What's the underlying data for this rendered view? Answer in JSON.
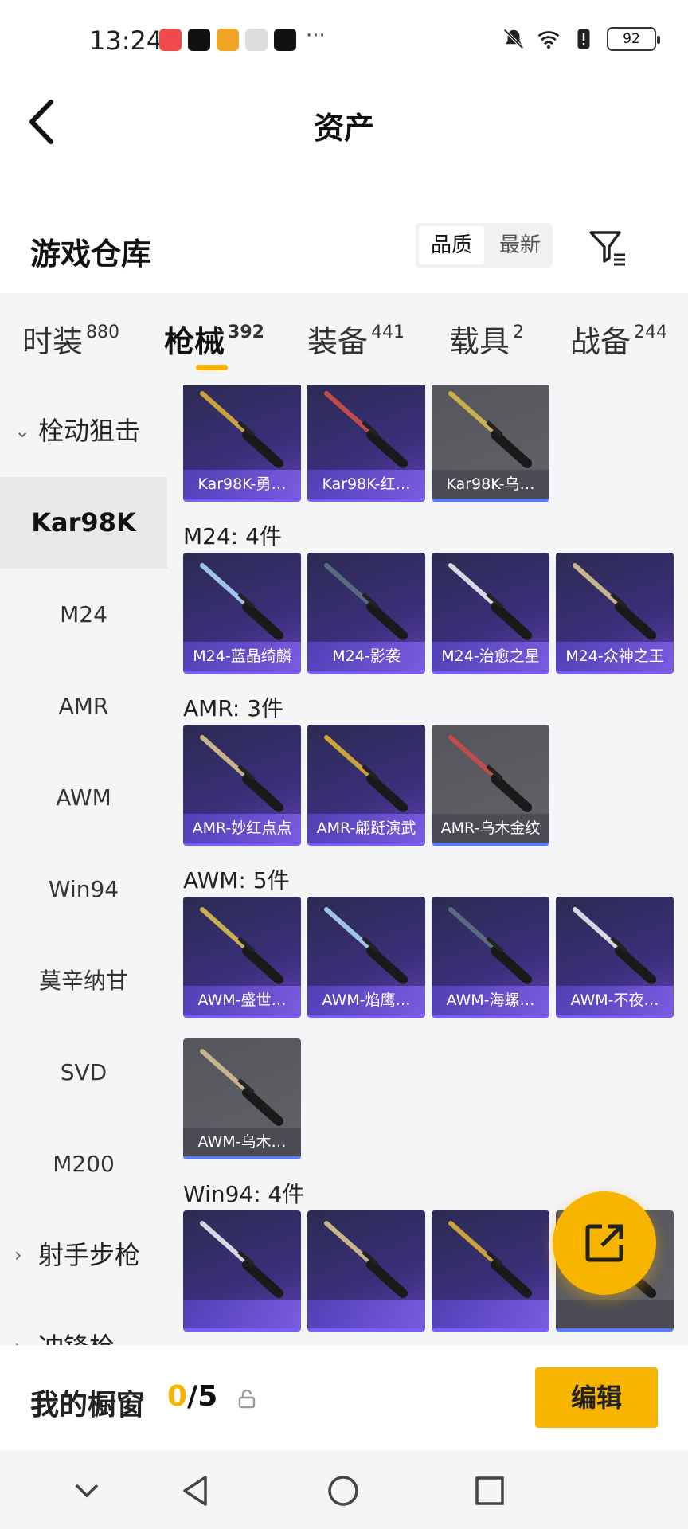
{
  "status_bar": {
    "time": "13:24",
    "dots": "···",
    "battery": "92"
  },
  "header": {
    "title": "资产"
  },
  "warehouse": {
    "title": "游戏仓库",
    "sort_options": [
      "品质",
      "最新"
    ],
    "active_sort": "品质"
  },
  "tabs": [
    {
      "label": "时装",
      "count": "880"
    },
    {
      "label": "枪械",
      "count": "392"
    },
    {
      "label": "装备",
      "count": "441"
    },
    {
      "label": "载具",
      "count": "2"
    },
    {
      "label": "战备",
      "count": "244"
    }
  ],
  "sidebar": {
    "categories": [
      {
        "label": "栓动狙击",
        "chevron": "down"
      },
      {
        "label": "射手步枪",
        "chevron": "right"
      },
      {
        "label": "冲锋枪",
        "chevron": "right"
      }
    ],
    "items": [
      "Kar98K",
      "M24",
      "AMR",
      "AWM",
      "Win94",
      "莫辛纳甘",
      "SVD",
      "M200"
    ],
    "active_item": "Kar98K"
  },
  "sections": [
    {
      "title": "",
      "cards": [
        {
          "label": "Kar98K-勇…",
          "style": "purple"
        },
        {
          "label": "Kar98K-红…",
          "style": "purple"
        },
        {
          "label": "Kar98K-乌…",
          "style": "gray"
        }
      ]
    },
    {
      "title": "M24: 4件",
      "cards": [
        {
          "label": "M24-蓝晶绮麟",
          "style": "purple"
        },
        {
          "label": "M24-影袭",
          "style": "purple"
        },
        {
          "label": "M24-治愈之星",
          "style": "purple"
        },
        {
          "label": "M24-众神之王",
          "style": "purple"
        }
      ]
    },
    {
      "title": "AMR: 3件",
      "cards": [
        {
          "label": "AMR-妙红点点",
          "style": "purple"
        },
        {
          "label": "AMR-翩跹演武",
          "style": "purple"
        },
        {
          "label": "AMR-乌木金纹",
          "style": "gray"
        }
      ]
    },
    {
      "title": "AWM: 5件",
      "cards": [
        {
          "label": "AWM-盛世…",
          "style": "purple"
        },
        {
          "label": "AWM-焰鹰…",
          "style": "purple"
        },
        {
          "label": "AWM-海螺…",
          "style": "purple"
        },
        {
          "label": "AWM-不夜…",
          "style": "purple"
        },
        {
          "label": "AWM-乌木…",
          "style": "gray"
        }
      ]
    },
    {
      "title": "Win94: 4件",
      "cards": [
        {
          "label": "",
          "style": "purple"
        },
        {
          "label": "",
          "style": "purple"
        },
        {
          "label": "",
          "style": "purple"
        },
        {
          "label": "",
          "style": "gray"
        }
      ]
    }
  ],
  "bottom_bar": {
    "showcase_label": "我的橱窗",
    "count_current": "0",
    "count_total": "/5",
    "edit_label": "编辑"
  },
  "icons": {
    "fab": "share-export-icon",
    "filter": "filter-icon",
    "lock": "lock-icon"
  },
  "colors": {
    "accent": "#f7b500",
    "card_purple": "#3a2f7a",
    "card_gray": "#5a5a60"
  }
}
